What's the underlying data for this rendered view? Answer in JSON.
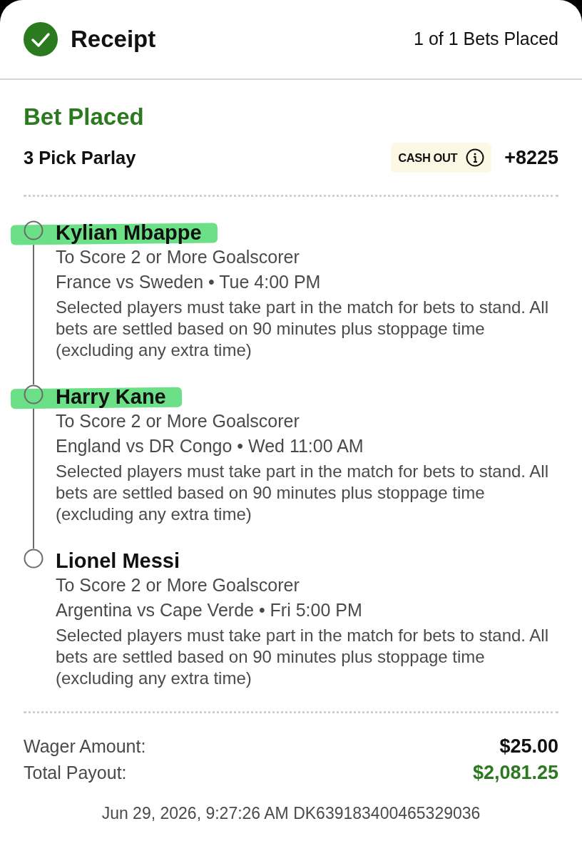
{
  "header": {
    "title": "Receipt",
    "status": "1 of 1 Bets Placed"
  },
  "bet": {
    "status": "Bet Placed",
    "type": "3 Pick Parlay",
    "cash_out": "CASH OUT",
    "odds": "+8225"
  },
  "legs": [
    {
      "player": "Kylian Mbappe",
      "highlighted": true,
      "market": "To Score 2 or More Goalscorer",
      "event": "France vs Sweden • Tue 4:00 PM",
      "note": "Selected players must take part in the match for bets to stand. All bets are settled based on 90 minutes plus stoppage time (excluding any extra time)"
    },
    {
      "player": "Harry Kane",
      "highlighted": true,
      "market": "To Score 2 or More Goalscorer",
      "event": "England vs DR Congo • Wed 11:00 AM",
      "note": "Selected players must take part in the match for bets to stand. All bets are settled based on 90 minutes plus stoppage time (excluding any extra time)"
    },
    {
      "player": "Lionel Messi",
      "highlighted": false,
      "market": "To Score 2 or More Goalscorer",
      "event": "Argentina vs Cape Verde • Fri 5:00 PM",
      "note": "Selected players must take part in the match for bets to stand. All bets are settled based on 90 minutes plus stoppage time (excluding any extra time)"
    }
  ],
  "summary": [
    {
      "label": "Wager Amount:",
      "value": "$25.00",
      "kind": "plain"
    },
    {
      "label": "Total Payout:",
      "value": "$2,081.25",
      "kind": "payout"
    }
  ],
  "footer": {
    "text": "Jun 29, 2026, 9:27:26 AM DK639183400465329036"
  }
}
